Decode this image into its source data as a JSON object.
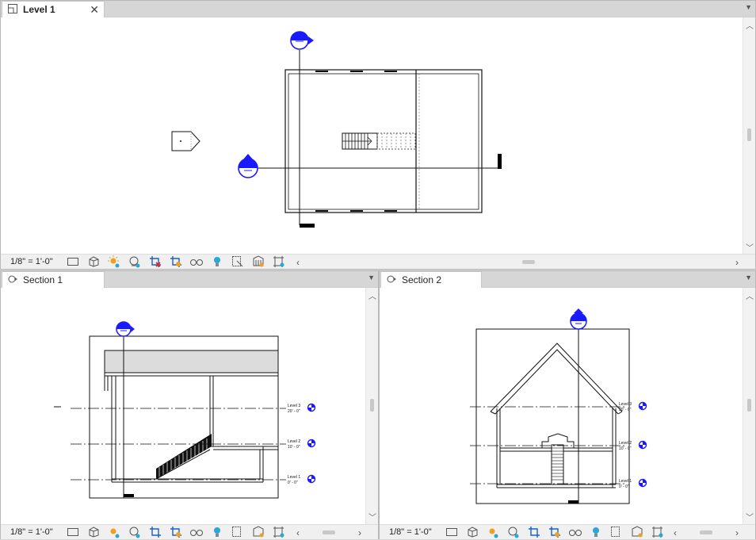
{
  "views": {
    "level1": {
      "tab_label": "Level 1",
      "close": "✕",
      "scale": "1/8\" = 1'-0\""
    },
    "section1": {
      "tab_label": "Section 1",
      "scale": "1/8\" = 1'-0\"",
      "levels": [
        {
          "name": "Level 3",
          "elevation": "20' - 0\""
        },
        {
          "name": "Level 2",
          "elevation": "10' - 0\""
        },
        {
          "name": "Level 1",
          "elevation": "0' - 0\""
        }
      ]
    },
    "section2": {
      "tab_label": "Section 2",
      "scale": "1/8\" = 1'-0\"",
      "levels": [
        {
          "name": "Level 3",
          "elevation": "20' - 0\""
        },
        {
          "name": "Level 2",
          "elevation": "10' - 0\""
        },
        {
          "name": "Level 1",
          "elevation": "0' - 0\""
        }
      ]
    }
  },
  "view_control_icons": [
    "detail-level-icon",
    "visual-style-icon",
    "sun-path-icon",
    "shadows-icon",
    "crop-view-icon",
    "show-crop-region-icon",
    "temporary-hide-icon",
    "reveal-hidden-icon",
    "temporary-view-properties-icon",
    "analytical-model-icon",
    "highlight-displacement-icon"
  ],
  "colors": {
    "accent_blue": "#1a1aff",
    "highlight_orange": "#f0a020",
    "highlight_cyan": "#27a8d8",
    "error_red": "#e02020"
  }
}
